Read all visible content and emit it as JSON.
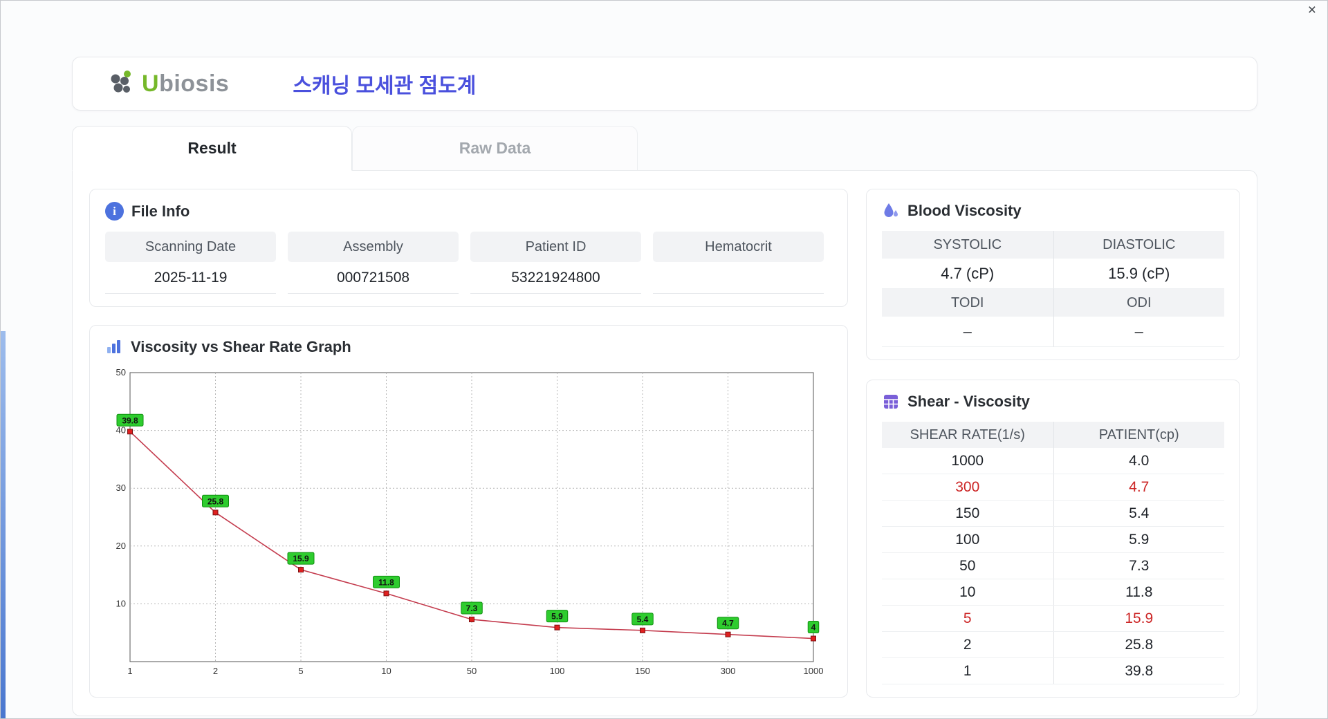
{
  "window": {
    "close_label": "×"
  },
  "header": {
    "brand_first_letter": "U",
    "brand_rest": "biosis",
    "app_title": "스캐닝 모세관 점도계"
  },
  "tabs": {
    "result": "Result",
    "raw_data": "Raw Data"
  },
  "file_info": {
    "title": "File Info",
    "fields": [
      {
        "label": "Scanning Date",
        "value": "2025-11-19"
      },
      {
        "label": "Assembly",
        "value": "000721508"
      },
      {
        "label": "Patient ID",
        "value": "53221924800"
      },
      {
        "label": "Hematocrit",
        "value": ""
      }
    ]
  },
  "blood_viscosity": {
    "title": "Blood Viscosity",
    "row1": {
      "label1": "SYSTOLIC",
      "label2": "DIASTOLIC",
      "value1": "4.7 (cP)",
      "value2": "15.9 (cP)"
    },
    "row2": {
      "label1": "TODI",
      "label2": "ODI",
      "value1": "–",
      "value2": "–"
    }
  },
  "shear_viscosity": {
    "title": "Shear - Viscosity",
    "columns": [
      "SHEAR RATE(1/s)",
      "PATIENT(cp)"
    ],
    "rows": [
      {
        "rate": "1000",
        "patient": "4.0",
        "highlight": false
      },
      {
        "rate": "300",
        "patient": "4.7",
        "highlight": true
      },
      {
        "rate": "150",
        "patient": "5.4",
        "highlight": false
      },
      {
        "rate": "100",
        "patient": "5.9",
        "highlight": false
      },
      {
        "rate": "50",
        "patient": "7.3",
        "highlight": false
      },
      {
        "rate": "10",
        "patient": "11.8",
        "highlight": false
      },
      {
        "rate": "5",
        "patient": "15.9",
        "highlight": true
      },
      {
        "rate": "2",
        "patient": "25.8",
        "highlight": false
      },
      {
        "rate": "1",
        "patient": "39.8",
        "highlight": false
      }
    ]
  },
  "chart_data": {
    "type": "line",
    "title": "Viscosity vs Shear Rate Graph",
    "xlabel": "",
    "ylabel": "",
    "categories": [
      "1",
      "2",
      "5",
      "10",
      "50",
      "100",
      "150",
      "300",
      "1000"
    ],
    "values": [
      39.8,
      25.8,
      15.9,
      11.8,
      7.3,
      5.9,
      5.4,
      4.7,
      4.0
    ],
    "point_labels": [
      "39.8",
      "25.8",
      "15.9",
      "11.8",
      "7.3",
      "5.9",
      "5.4",
      "4.7",
      "4"
    ],
    "ylim": [
      0,
      50
    ],
    "yticks": [
      10,
      20,
      30,
      40,
      50
    ],
    "grid": true,
    "legend": "none",
    "line_color": "#c43c4e",
    "marker_color": "#e02020",
    "marker_border": "#7a1010",
    "label_bg": "#2ecc2e",
    "label_border": "#0f8f0f"
  },
  "colors": {
    "accent_blue": "#4a50dd",
    "highlight_red": "#cc2525",
    "brand_green": "#76b82a"
  }
}
